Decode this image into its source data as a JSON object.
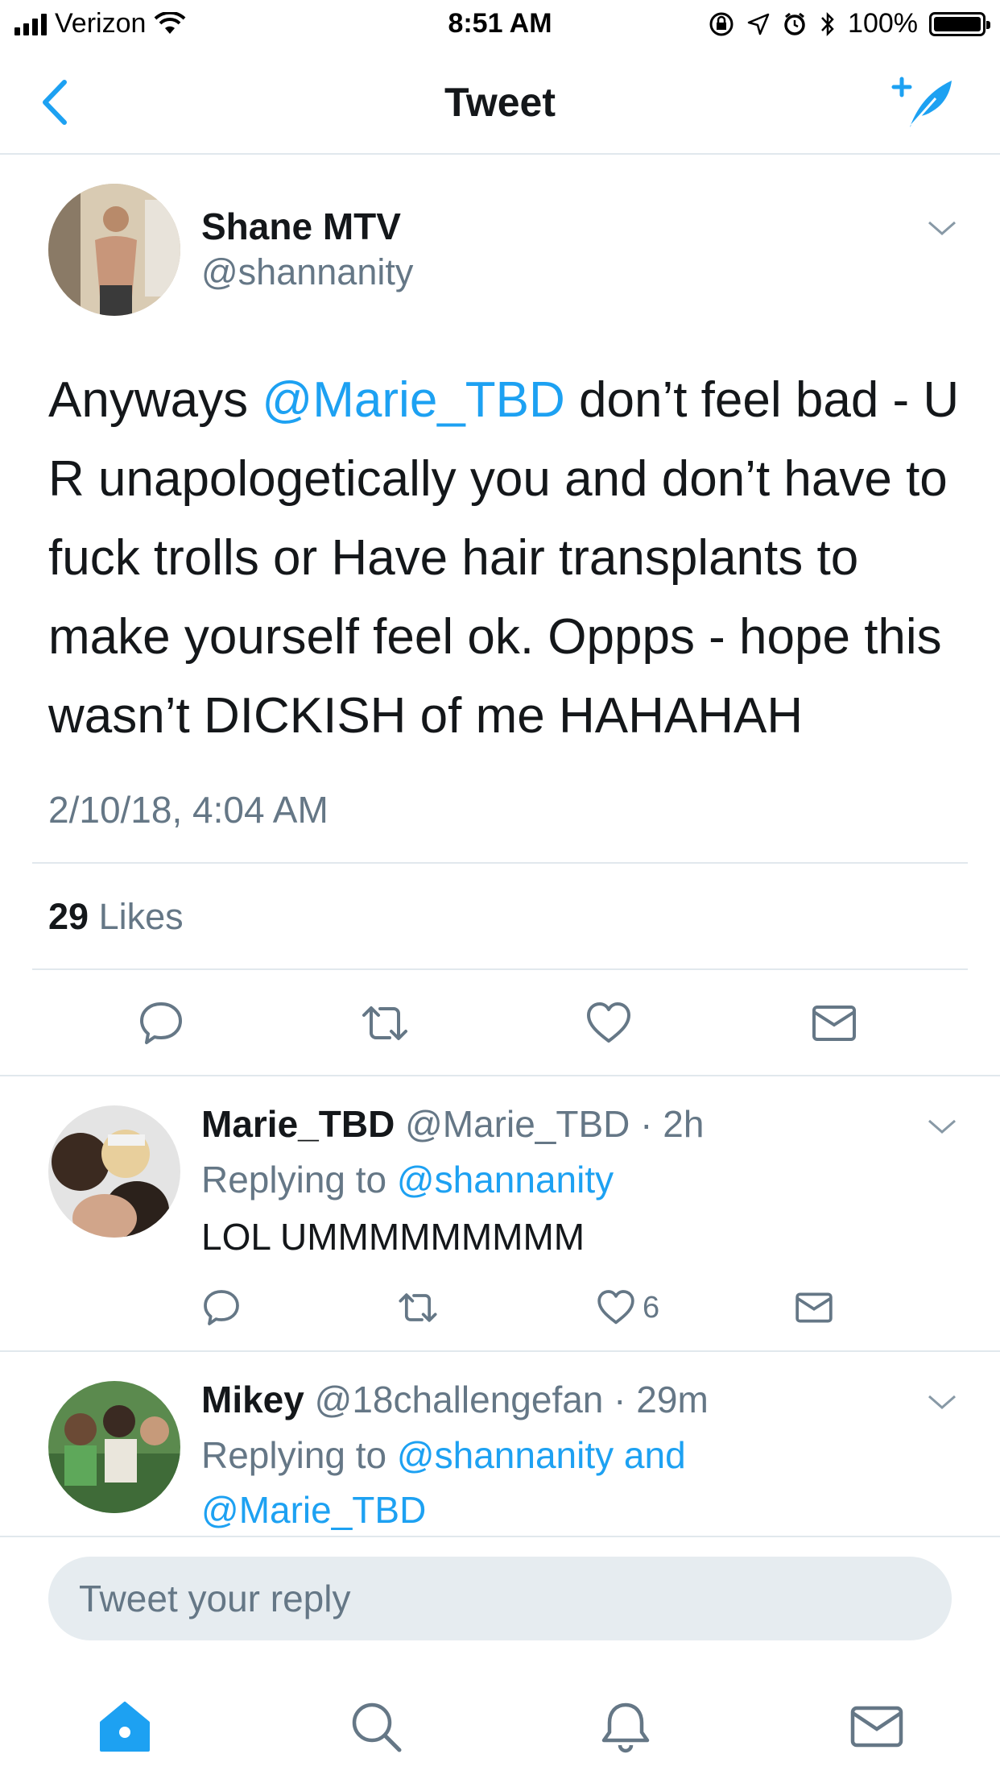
{
  "status_bar": {
    "carrier": "Verizon",
    "time": "8:51 AM",
    "battery": "100%"
  },
  "nav": {
    "title": "Tweet"
  },
  "main_tweet": {
    "name": "Shane MTV",
    "handle": "@shannanity",
    "text_parts": [
      "Anyways ",
      "@Marie_TBD",
      " don’t feel bad - U R unapologetically you and don’t have to fuck trolls or Have hair transplants to make yourself feel ok.  Oppps - hope this wasn’t DICKISH of me HAHAHAH"
    ],
    "timestamp": "2/10/18, 4:04 AM",
    "likes_count": "29",
    "likes_label": "Likes"
  },
  "replies": [
    {
      "name": "Marie_TBD",
      "handle": "@Marie_TBD",
      "time": "2h",
      "replying_prefix": "Replying to ",
      "replying_to": "@shannanity",
      "text": "LOL UMMMMMMMMM",
      "like_count": "6"
    },
    {
      "name": "Mikey",
      "handle": "@18challengefan",
      "time": "29m",
      "replying_prefix": "Replying to ",
      "replying_to": "@shannanity and @Marie_TBD"
    }
  ],
  "reply_bar": {
    "placeholder": "Tweet your reply"
  },
  "icons": {
    "accent": "#1da1f2",
    "gray": "#657786",
    "nav_back": "chevron-left-icon",
    "compose": "compose-feather-icon",
    "tabs": [
      "home-icon",
      "search-icon",
      "notifications-bell-icon",
      "messages-envelope-icon"
    ]
  }
}
